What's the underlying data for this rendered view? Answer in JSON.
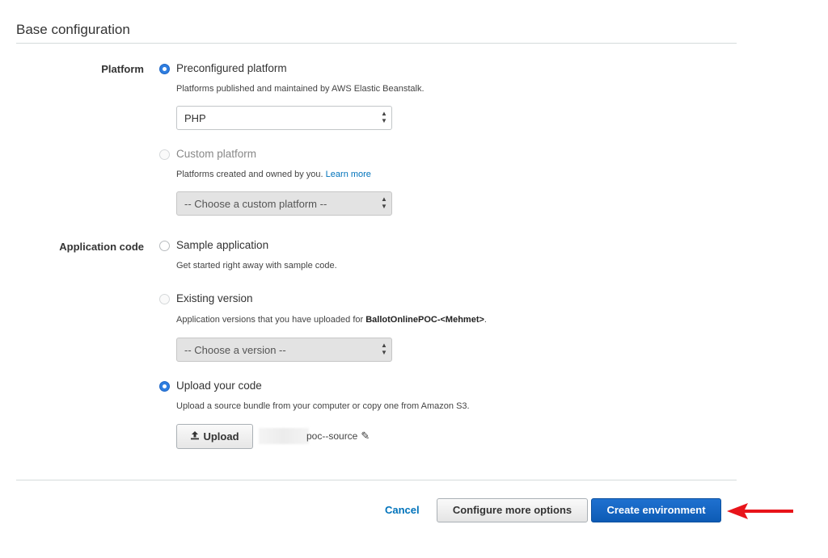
{
  "section": {
    "title": "Base configuration"
  },
  "platform": {
    "label": "Platform",
    "preconfigured": {
      "label": "Preconfigured platform",
      "description": "Platforms published and maintained by AWS Elastic Beanstalk.",
      "selected": true,
      "select_value": "PHP"
    },
    "custom": {
      "label": "Custom platform",
      "description": "Platforms created and owned by you.",
      "learn_more": "Learn more",
      "selected": false,
      "select_value": "-- Choose a custom platform --"
    }
  },
  "application_code": {
    "label": "Application code",
    "sample": {
      "label": "Sample application",
      "description": "Get started right away with sample code.",
      "selected": false
    },
    "existing": {
      "label": "Existing version",
      "description_prefix": "Application versions that you have uploaded for ",
      "app_name": "BallotOnlinePOC-<Mehmet>",
      "description_suffix": ".",
      "selected": false,
      "select_value": "-- Choose a version --"
    },
    "upload": {
      "label": "Upload your code",
      "description": "Upload a source bundle from your computer or copy one from Amazon S3.",
      "selected": true,
      "button_label": "Upload",
      "file_name": "poc--source"
    }
  },
  "footer": {
    "cancel_label": "Cancel",
    "configure_label": "Configure more options",
    "create_label": "Create environment"
  },
  "colors": {
    "primary": "#0d5bb5",
    "link": "#0073bb",
    "radio_selected": "#2f7ee0",
    "annotation_arrow": "#e8141a"
  }
}
